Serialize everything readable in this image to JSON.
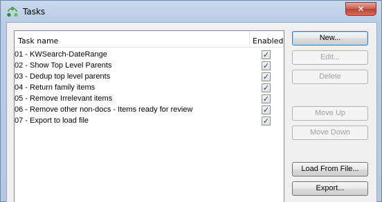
{
  "window": {
    "title": "Tasks",
    "close_glyph": "✕",
    "app_icon": "green-circular-arrows-icon"
  },
  "list": {
    "columns": {
      "name": "Task name",
      "enabled": "Enabled"
    },
    "rows": [
      {
        "name": "01 - KWSearch-DateRange",
        "enabled": true
      },
      {
        "name": "02 - Show Top Level Parents",
        "enabled": true
      },
      {
        "name": "03 - Dedup top level parents",
        "enabled": true
      },
      {
        "name": "04 - Return family items",
        "enabled": true
      },
      {
        "name": "05 - Remove Irrelevant items",
        "enabled": true
      },
      {
        "name": "06 - Remove other non-docs - Items ready for review",
        "enabled": true
      },
      {
        "name": "07 - Export to load file",
        "enabled": true
      }
    ],
    "check_glyph": "✓"
  },
  "buttons": {
    "new": "New...",
    "edit": "Edit...",
    "delete": "Delete",
    "move_up": "Move Up",
    "move_down": "Move Down",
    "load_from_file": "Load From File...",
    "export": "Export..."
  }
}
